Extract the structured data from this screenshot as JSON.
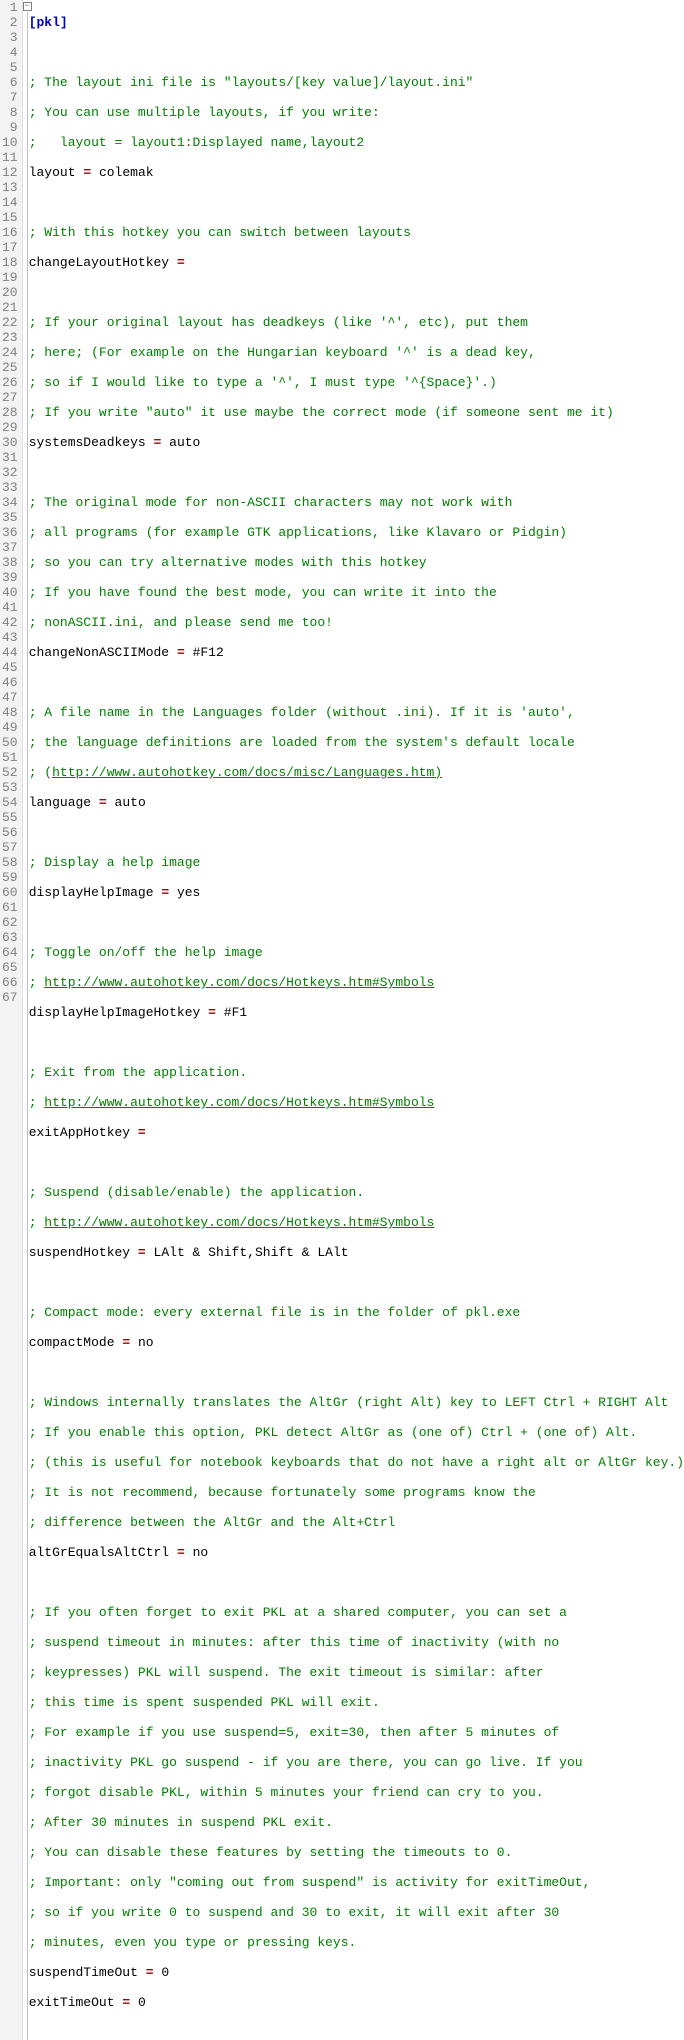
{
  "section": "[pkl]",
  "fold_symbol": "−",
  "lines": {
    "l3": "; The layout ini file is \"layouts/[key value]/layout.ini\"",
    "l4": "; You can use multiple layouts, if you write:",
    "l5": ";   layout = layout1:Displayed name,layout2",
    "l6k": "layout",
    "l6v": "colemak",
    "l8": "; With this hotkey you can switch between layouts",
    "l9k": "changeLayoutHotkey",
    "l11": "; If your original layout has deadkeys (like '^', etc), put them",
    "l12": "; here; (For example on the Hungarian keyboard '^' is a dead key,",
    "l13": "; so if I would like to type a '^', I must type '^{Space}'.)",
    "l14": "; If you write \"auto\" it use maybe the correct mode (if someone sent me it)",
    "l15k": "systemsDeadkeys",
    "l15v": "auto",
    "l17": "; The original mode for non-ASCII characters may not work with",
    "l18": "; all programs (for example GTK applications, like Klavaro or Pidgin)",
    "l19": "; so you can try alternative modes with this hotkey",
    "l20": "; If you have found the best mode, you can write it into the",
    "l21": "; nonASCII.ini, and please send me too!",
    "l22k": "changeNonASCIIMode",
    "l22v": "#F12",
    "l24": "; A file name in the Languages folder (without .ini). If it is 'auto',",
    "l25": "; the language definitions are loaded from the system's default locale",
    "l26a": "; (",
    "l26b": "http://www.autohotkey.com/docs/misc/Languages.htm)",
    "l27k": "language",
    "l27v": "auto",
    "l29": "; Display a help image",
    "l30k": "displayHelpImage",
    "l30v": "yes",
    "l32": "; Toggle on/off the help image",
    "l33a": "; ",
    "l33b": "http://www.autohotkey.com/docs/Hotkeys.htm#Symbols",
    "l34k": "displayHelpImageHotkey",
    "l34v": "#F1",
    "l36": "; Exit from the application.",
    "l37a": "; ",
    "l37b": "http://www.autohotkey.com/docs/Hotkeys.htm#Symbols",
    "l38k": "exitAppHotkey",
    "l40": "; Suspend (disable/enable) the application.",
    "l41a": "; ",
    "l41b": "http://www.autohotkey.com/docs/Hotkeys.htm#Symbols",
    "l42k": "suspendHotkey",
    "l42v": "LAlt & Shift,Shift & LAlt",
    "l44": "; Compact mode: every external file is in the folder of pkl.exe",
    "l45k": "compactMode",
    "l45v": "no",
    "l47": "; Windows internally translates the AltGr (right Alt) key to LEFT Ctrl + RIGHT Alt",
    "l48": "; If you enable this option, PKL detect AltGr as (one of) Ctrl + (one of) Alt.",
    "l49": "; (this is useful for notebook keyboards that do not have a right alt or AltGr key.)",
    "l50": "; It is not recommend, because fortunately some programs know the",
    "l51": "; difference between the AltGr and the Alt+Ctrl",
    "l52k": "altGrEqualsAltCtrl",
    "l52v": "no",
    "l54": "; If you often forget to exit PKL at a shared computer, you can set a",
    "l55": "; suspend timeout in minutes: after this time of inactivity (with no",
    "l56": "; keypresses) PKL will suspend. The exit timeout is similar: after",
    "l57": "; this time is spent suspended PKL will exit.",
    "l58": "; For example if you use suspend=5, exit=30, then after 5 minutes of",
    "l59": "; inactivity PKL go suspend - if you are there, you can go live. If you",
    "l60": "; forgot disable PKL, within 5 minutes your friend can cry to you.",
    "l61": "; After 30 minutes in suspend PKL exit.",
    "l62": "; You can disable these features by setting the timeouts to 0.",
    "l63": "; Important: only \"coming out from suspend\" is activity for exitTimeOut,",
    "l64": "; so if you write 0 to suspend and 30 to exit, it will exit after 30",
    "l65": "; minutes, even you type or pressing keys.",
    "l66k": "suspendTimeOut",
    "l66v": "0",
    "l67k": "exitTimeOut",
    "l67v": "0"
  }
}
